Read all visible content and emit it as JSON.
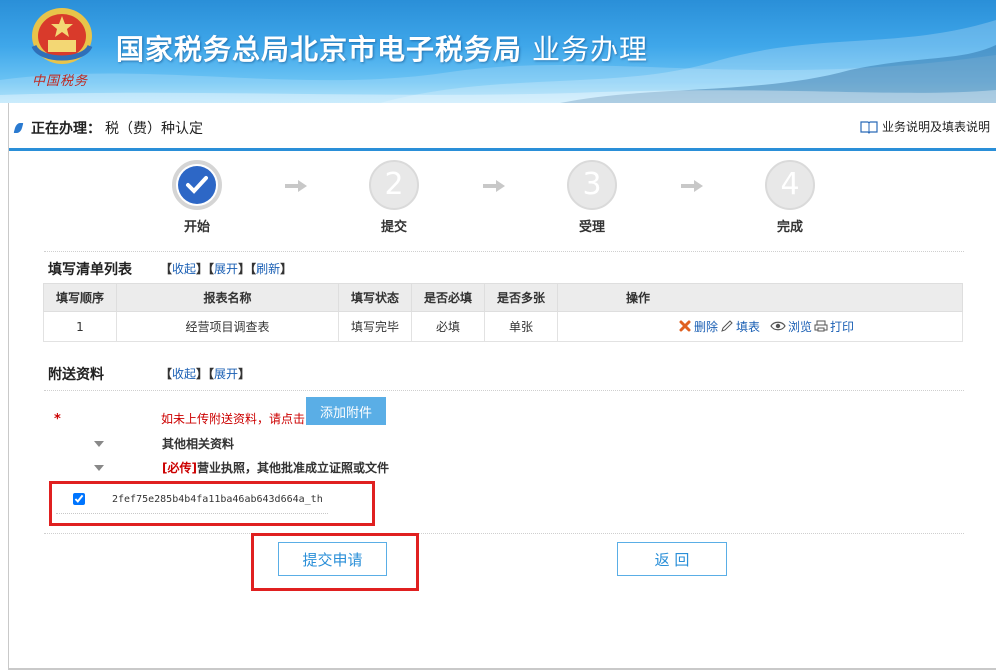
{
  "banner": {
    "title": "国家税务总局北京市电子税务局",
    "subtitle": "业务办理",
    "emblem_text": "中国税务",
    "emblem_icon": "tax-emblem-icon"
  },
  "status": {
    "label": "正在办理：",
    "value": "税（费）种认定",
    "help_link": "业务说明及填表说明"
  },
  "steps": [
    {
      "label": "开始",
      "number": "",
      "state": "done"
    },
    {
      "label": "提交",
      "number": "2",
      "state": "pending"
    },
    {
      "label": "受理",
      "number": "3",
      "state": "pending"
    },
    {
      "label": "完成",
      "number": "4",
      "state": "pending"
    }
  ],
  "form_list": {
    "title": "填写清单列表",
    "collapse": "收起",
    "expand": "展开",
    "refresh": "刷新",
    "columns": [
      "填写顺序",
      "报表名称",
      "填写状态",
      "是否必填",
      "是否多张",
      "操作"
    ],
    "rows": [
      {
        "order": "1",
        "name": "经营项目调查表",
        "status": "填写完毕",
        "required": "必填",
        "multiple": "单张",
        "actions": {
          "delete": "删除",
          "fill": "填表",
          "view": "浏览",
          "print": "打印"
        }
      }
    ]
  },
  "attachments": {
    "title": "附送资料",
    "collapse": "收起",
    "expand": "展开",
    "required_mark": "*",
    "upload_hint": "如未上传附送资料，请点击",
    "add_button": "添加附件",
    "items": [
      {
        "tag": "",
        "label": "其他相关资料"
      },
      {
        "tag": "[必传]",
        "label": "营业执照，其他批准成立证照或文件"
      }
    ],
    "file": {
      "name": "2fef75e285b4b4fa11ba46ab643d664a_th",
      "checked": true
    }
  },
  "actions": {
    "submit": "提交申请",
    "back": "返 回"
  },
  "colors": {
    "brand_blue": "#2a8fd8",
    "step_done": "#2d67c6",
    "highlight_red": "#e02020",
    "required_red": "#cc0000",
    "link_blue": "#1a5fb4"
  }
}
